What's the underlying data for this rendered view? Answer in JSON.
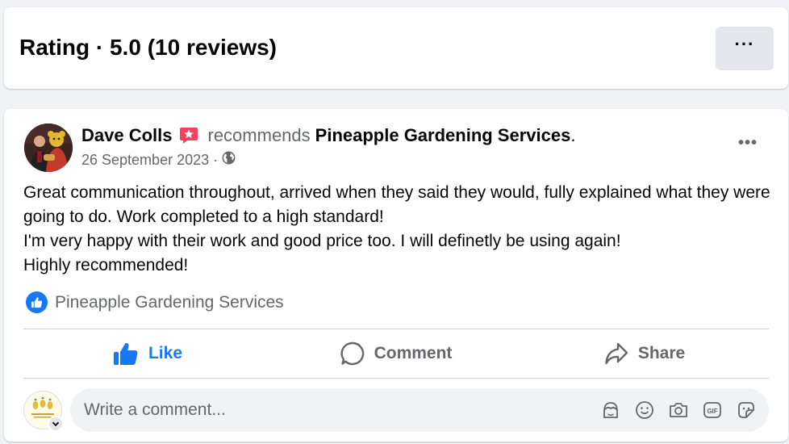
{
  "header": {
    "rating_title": "Rating · 5.0 (10 reviews)",
    "more_label": "···"
  },
  "review": {
    "author": "Dave Colls",
    "verb": "recommends",
    "page_name": "Pineapple Gardening Services",
    "period": ".",
    "date": "26 September 2023",
    "date_separator": "·",
    "more_label": "•••",
    "body_lines": [
      "Great communication throughout, arrived when they said they would, fully explained what they were going to do. Work completed to a high standard!",
      "I'm very happy with their work and good price too. I will definetly be using again!",
      "Highly recommended!"
    ],
    "liked_by": "Pineapple Gardening Services"
  },
  "actions": {
    "like": "Like",
    "comment": "Comment",
    "share": "Share"
  },
  "comment": {
    "placeholder": "Write a comment..."
  },
  "icons": {
    "recommend": "recommend-star-icon",
    "privacy": "globe-icon",
    "liked": "thumbs-up-icon",
    "comment_tools": [
      "avatar-sticker-icon",
      "emoji-icon",
      "camera-icon",
      "gif-icon",
      "sticker-icon"
    ]
  },
  "colors": {
    "accent": "#1877f2",
    "recommend": "#f3425f",
    "secondary_text": "#65676b",
    "page_bg": "#f0f2f5"
  }
}
